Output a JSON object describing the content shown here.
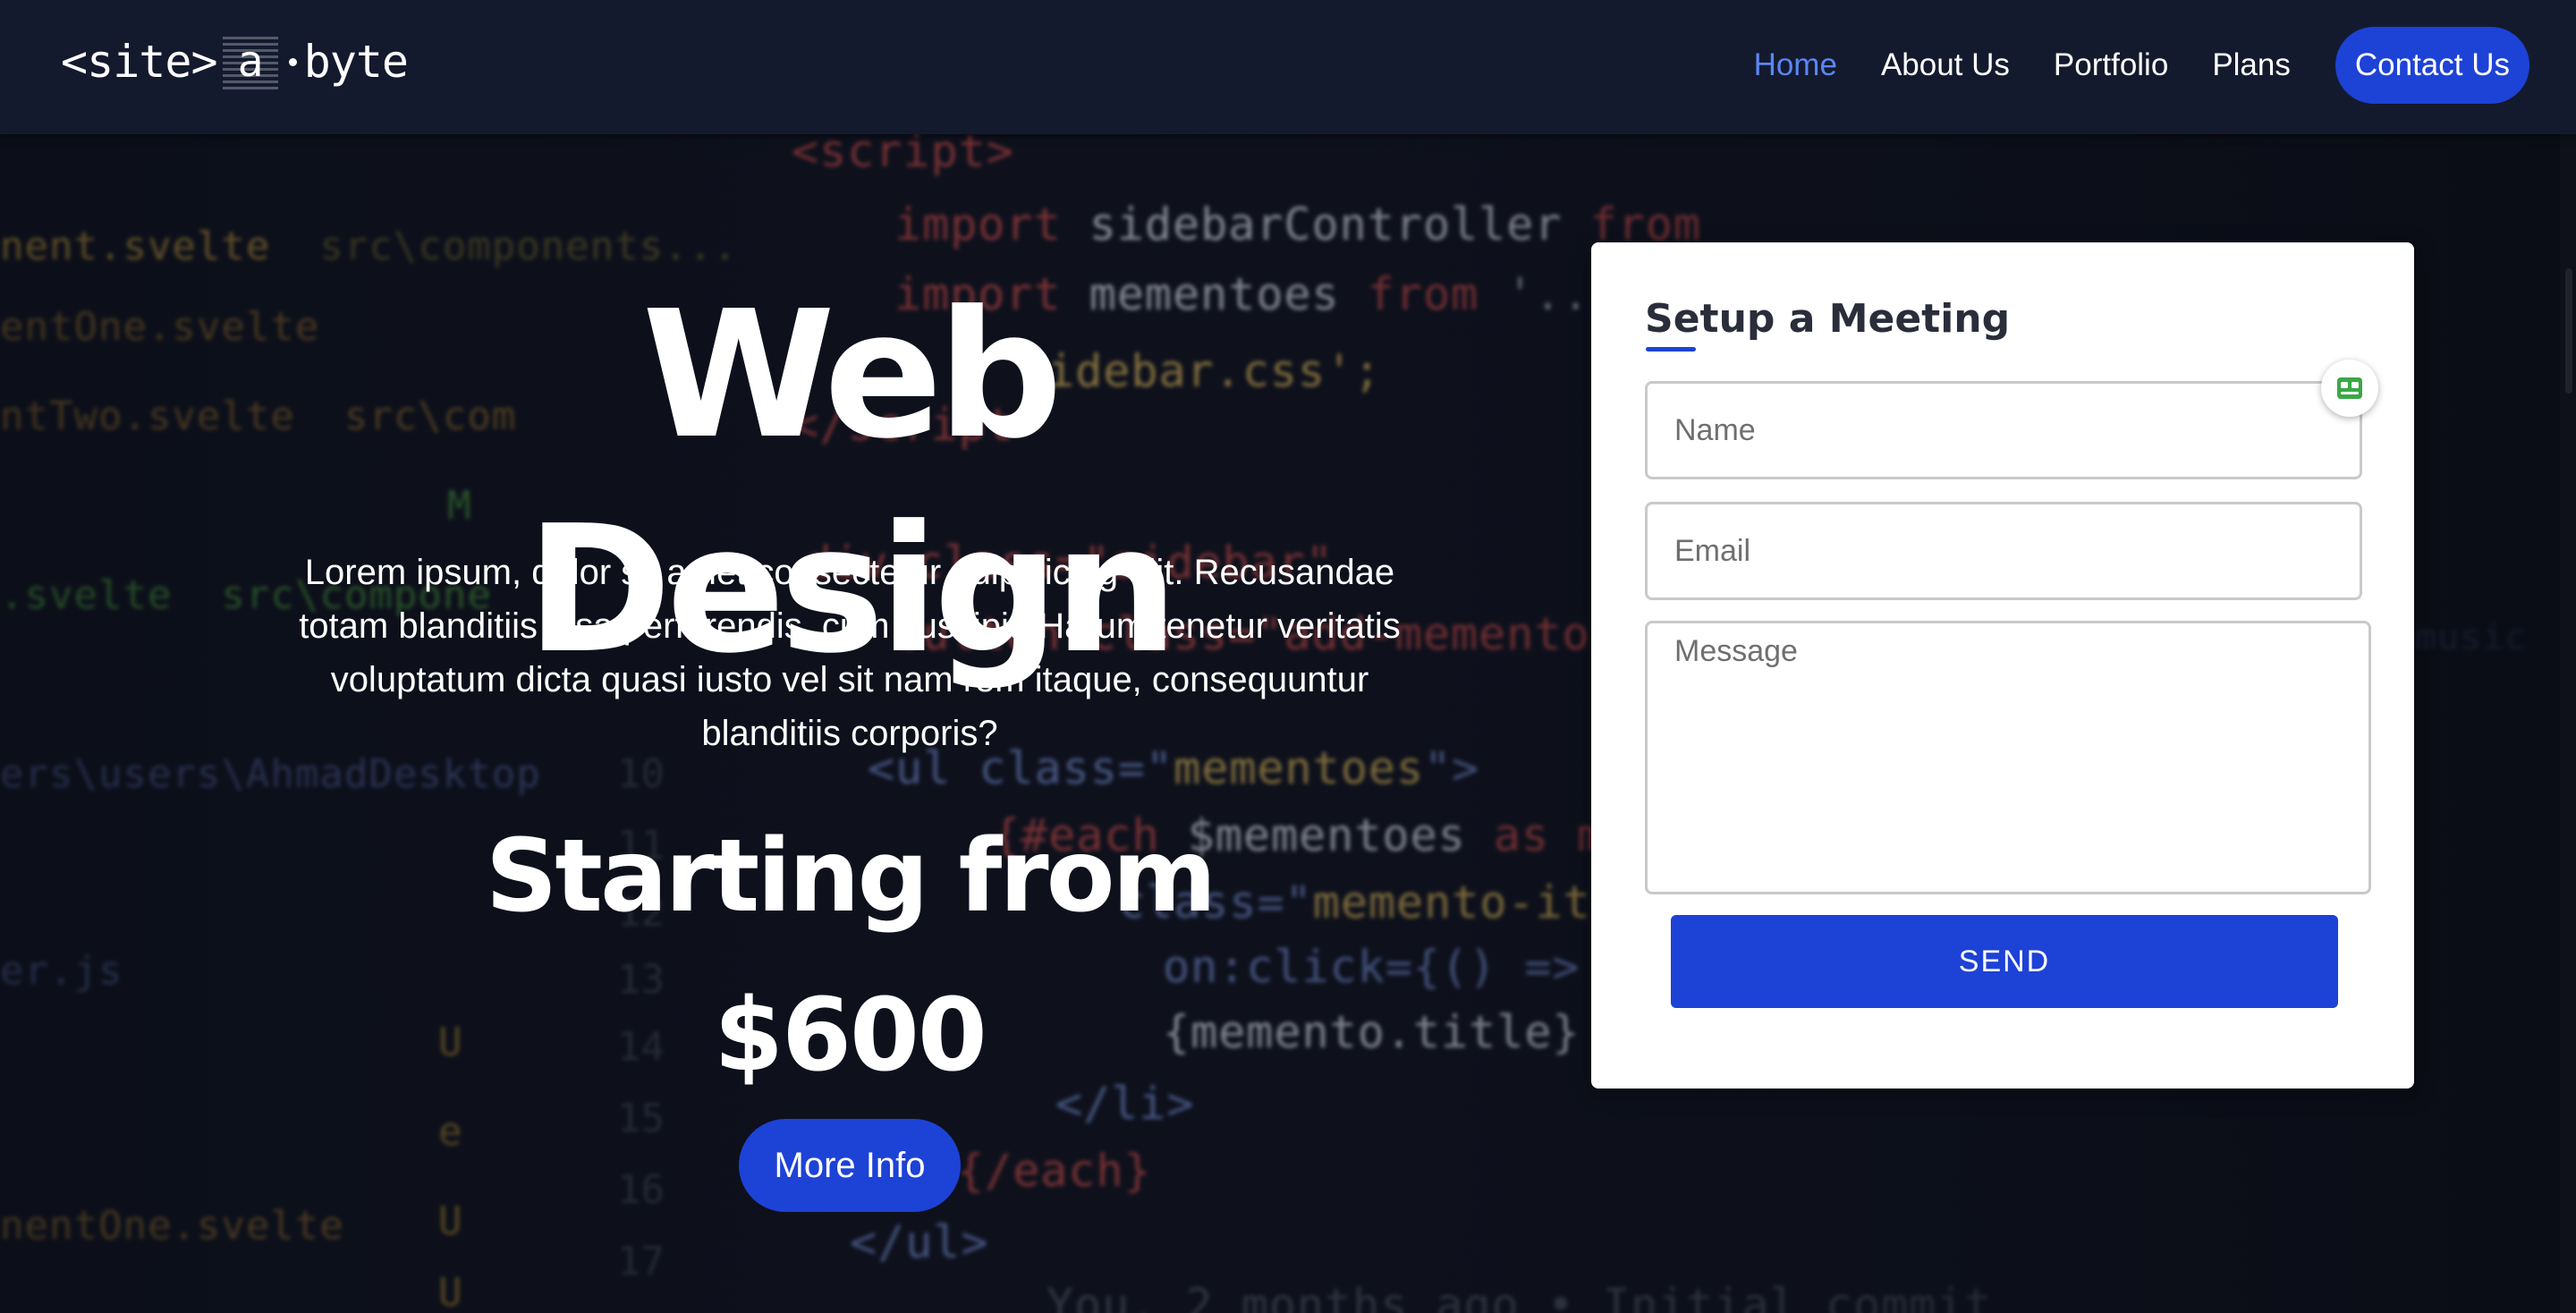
{
  "header": {
    "logo": {
      "left": "<site>",
      "middle": "a",
      "right": "byte"
    },
    "nav": [
      {
        "label": "Home",
        "active": true
      },
      {
        "label": "About Us",
        "active": false
      },
      {
        "label": "Portfolio",
        "active": false
      },
      {
        "label": "Plans",
        "active": false
      }
    ],
    "cta_label": "Contact Us"
  },
  "hero": {
    "title": "Web Design",
    "description": "Lorem ipsum, dolor sit amet consectetur adipisicing elit. Recusandae totam blanditiis ipsa perferendis, cum suscipit. Harum tenetur veritatis voluptatum dicta quasi iusto vel sit nam rem itaque, consequuntur blanditiis corporis?",
    "starting_from": "Starting from",
    "price": "$600",
    "more_info_label": "More Info"
  },
  "form": {
    "title": "Setup a Meeting",
    "name_placeholder": "Name",
    "email_placeholder": "Email",
    "message_placeholder": "Message",
    "send_label": "SEND"
  },
  "colors": {
    "accent": "#1d42d6",
    "nav_active": "#5a86f5",
    "navbar_bg": "#141a2e",
    "card_bg": "#ffffff",
    "extension_icon": "#3aa845"
  },
  "icons": {
    "extension_badge": "password-manager-icon"
  }
}
